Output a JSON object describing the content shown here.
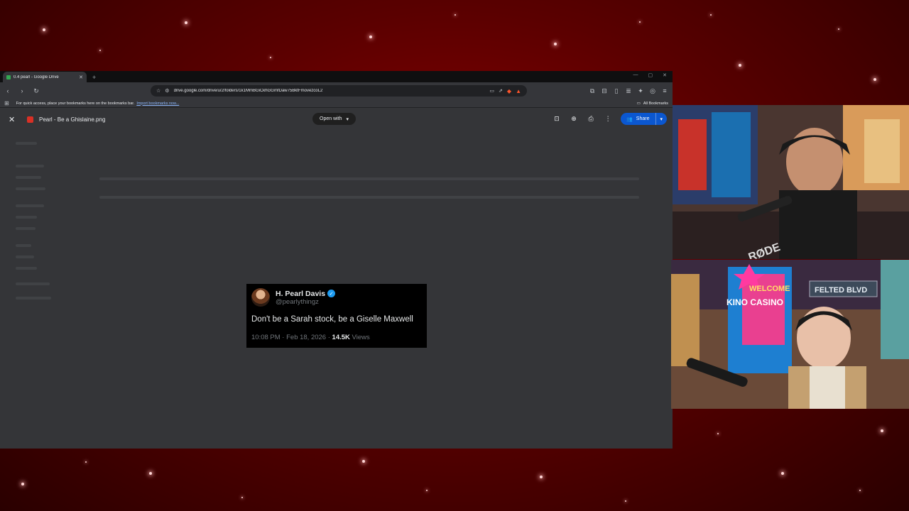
{
  "browser": {
    "tab": {
      "title": "0.4 pearl - Google Drive"
    },
    "url": "drive.google.com/drive/u/2/folders/1k1MmBGiCkhGGmfDaw75BktFmovezcoL2",
    "bookmarks_bar": {
      "prompt": "For quick access, place your bookmarks here on the bookmarks bar.",
      "import_link": "Import bookmarks now...",
      "all_bookmarks": "All Bookmarks"
    }
  },
  "drive_viewer": {
    "file_name": "Pearl - Be a Ghislaine.png",
    "open_with_label": "Open with",
    "share_label": "Share"
  },
  "tweet": {
    "display_name": "H. Pearl Davis",
    "handle": "@pearlythingz",
    "text": "Don't be a Sarah stock, be a Giselle Maxwell",
    "time": "10:08 PM · Feb 18, 2026 ·",
    "views_count": "14.5K",
    "views_label": "Views"
  },
  "webcam_overlay": {
    "sign_welcome": "WELCOME",
    "sign_casino": "KINO CASINO",
    "sign_street": "FELTED BLVD",
    "mic_brand": "RØDE"
  },
  "colors": {
    "background_red": "#8a0000",
    "share_button": "#0b57d0",
    "verified_badge": "#1d9bf0"
  }
}
